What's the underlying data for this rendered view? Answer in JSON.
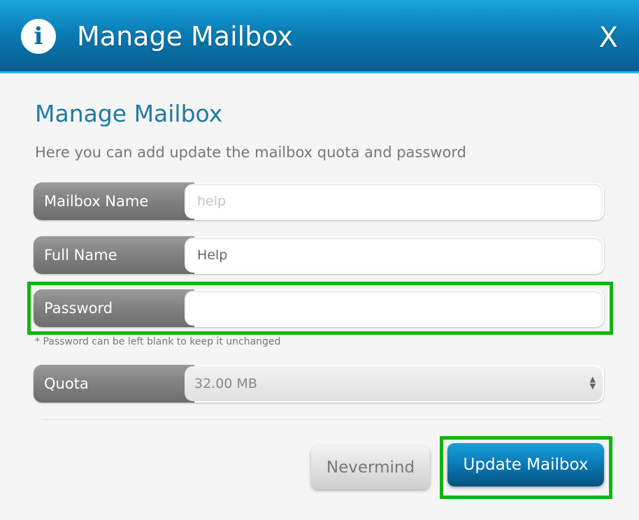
{
  "window": {
    "title": "Manage Mailbox",
    "close_label": "X",
    "info_glyph": "i"
  },
  "form": {
    "heading": "Manage Mailbox",
    "subtitle": "Here you can add update the mailbox quota and password",
    "mailbox_name": {
      "label": "Mailbox Name",
      "placeholder": "help",
      "value": ""
    },
    "full_name": {
      "label": "Full Name",
      "value": "Help"
    },
    "password": {
      "label": "Password",
      "value": "",
      "note": "* Password can be left blank to keep it unchanged"
    },
    "quota": {
      "label": "Quota",
      "selected": "32.00 MB"
    }
  },
  "actions": {
    "cancel_label": "Nevermind",
    "submit_label": "Update Mailbox"
  },
  "colors": {
    "accent": "#0b7cb5",
    "highlight": "#11b40f"
  }
}
